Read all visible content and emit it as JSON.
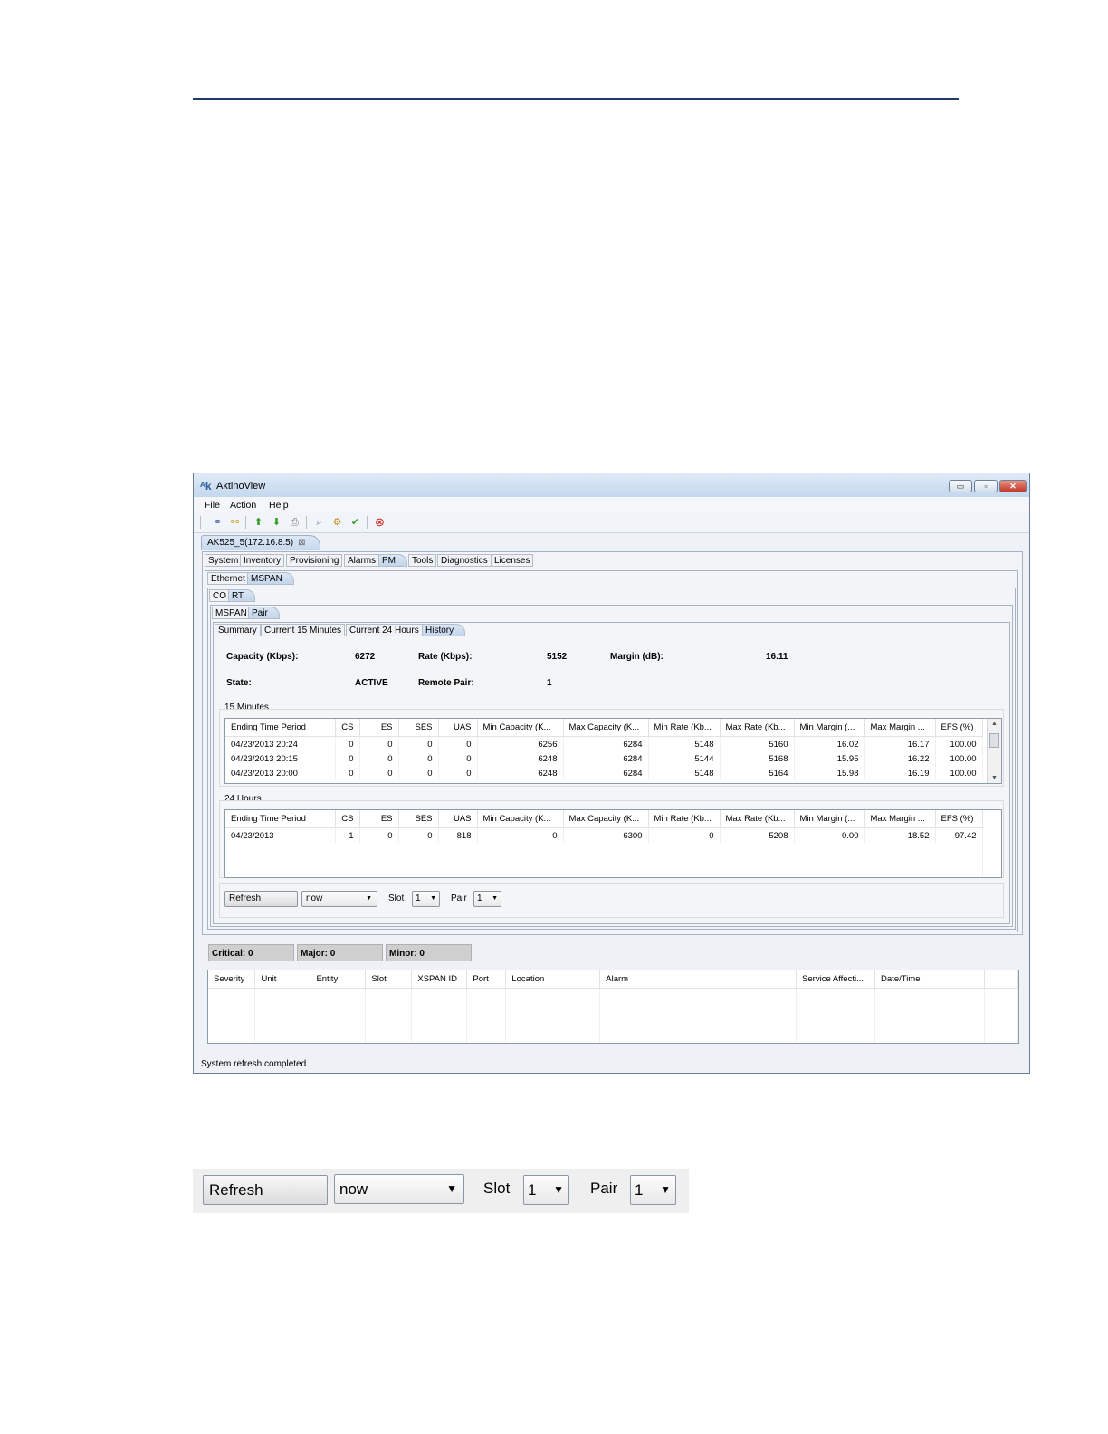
{
  "window": {
    "title": "AktinoView",
    "buttons": {
      "minimize": "▭",
      "maximize": "▫",
      "close": "✕"
    }
  },
  "menu": [
    "File",
    "Action",
    "Help"
  ],
  "session_tab": {
    "label": "AK525_5(172.16.8.5)",
    "close": "⊠"
  },
  "main_tabs": [
    "System",
    "Inventory",
    "Provisioning",
    "Alarms",
    "PM",
    "Tools",
    "Diagnostics",
    "Licenses"
  ],
  "pm_tabs": [
    "Ethernet",
    "MSPAN"
  ],
  "side_tabs": [
    "CO",
    "RT"
  ],
  "mspan_tabs": [
    "MSPAN",
    "Pair"
  ],
  "view_tabs": [
    "Summary",
    "Current 15 Minutes",
    "Current 24 Hours",
    "History"
  ],
  "summary": {
    "capacity_label": "Capacity (Kbps):",
    "capacity_value": "6272",
    "rate_label": "Rate (Kbps):",
    "rate_value": "5152",
    "margin_label": "Margin (dB):",
    "margin_value": "16.11",
    "state_label": "State:",
    "state_value": "ACTIVE",
    "remote_pair_label": "Remote Pair:",
    "remote_pair_value": "1"
  },
  "table_columns": [
    "Ending Time Period",
    "CS",
    "ES",
    "SES",
    "UAS",
    "Min Capacity (K...",
    "Max Capacity (K...",
    "Min Rate (Kb...",
    "Max Rate (Kb...",
    "Min Margin (...",
    "Max Margin ...",
    "EFS (%)"
  ],
  "fifteen_min": {
    "label": "15 Minutes",
    "rows": [
      [
        "04/23/2013 20:24",
        "0",
        "0",
        "0",
        "0",
        "6256",
        "6284",
        "5148",
        "5160",
        "16.02",
        "16.17",
        "100.00"
      ],
      [
        "04/23/2013 20:15",
        "0",
        "0",
        "0",
        "0",
        "6248",
        "6284",
        "5144",
        "5168",
        "15.95",
        "16.22",
        "100.00"
      ],
      [
        "04/23/2013 20:00",
        "0",
        "0",
        "0",
        "0",
        "6248",
        "6284",
        "5148",
        "5164",
        "15.98",
        "16.19",
        "100.00"
      ]
    ]
  },
  "twentyfour_hr": {
    "label": "24 Hours",
    "rows": [
      [
        "04/23/2013",
        "1",
        "0",
        "0",
        "818",
        "0",
        "6300",
        "0",
        "5208",
        "0.00",
        "18.52",
        "97.42"
      ]
    ]
  },
  "controls": {
    "refresh_label": "Refresh",
    "time_value": "now",
    "slot_label": "Slot",
    "slot_value": "1",
    "pair_label": "Pair",
    "pair_value": "1",
    "dropdown_arrow": "▼"
  },
  "alarm_counts": {
    "critical": "Critical: 0",
    "major": "Major: 0",
    "minor": "Minor: 0"
  },
  "alarm_columns": [
    "Severity",
    "Unit",
    "Entity",
    "Slot",
    "XSPAN ID",
    "Port",
    "Location",
    "Alarm",
    "Service Affecti...",
    "Date/Time"
  ],
  "status": "System refresh completed",
  "icons": [
    "connect-icon",
    "disconnect-icon",
    "upload-icon",
    "download-icon",
    "print-icon",
    "find-icon",
    "settings-icon",
    "check-icon",
    "stop-icon"
  ]
}
